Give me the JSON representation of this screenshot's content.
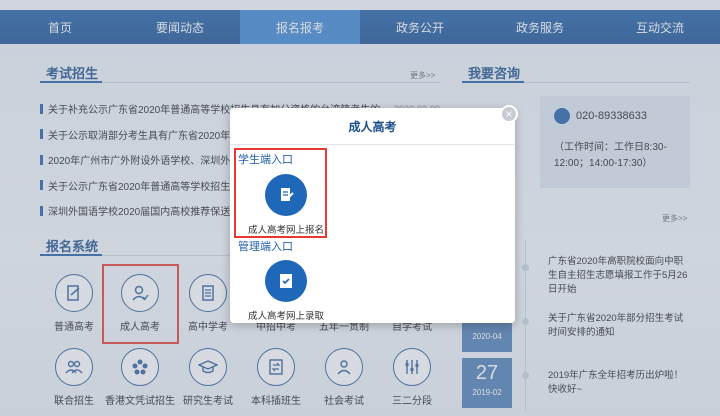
{
  "nav": {
    "items": [
      "首页",
      "要闻动态",
      "报名报考",
      "政务公开",
      "政务服务",
      "互动交流"
    ],
    "active_index": 2
  },
  "exam_section": {
    "title": "考试招生",
    "more": "更多>>",
    "news": [
      {
        "text": "关于补充公示广东省2020年普通高等学校招生具有加分资格的台湾籍考生的",
        "date": "2020-03-09"
      },
      {
        "text": "关于公示取消部分考生具有广东省2020年普通高",
        "date": ""
      },
      {
        "text": "2020年广州市广外附设外语学校、深圳外国语",
        "date": ""
      },
      {
        "text": "关于公示广东省2020年普通高等学校招生具有",
        "date": ""
      },
      {
        "text": "深圳外国语学校2020届国内高校推荐保送生工",
        "date": ""
      }
    ]
  },
  "reg_section": {
    "title": "报名系统",
    "icons": [
      {
        "label": "普通高考",
        "icon": "edit-doc-icon"
      },
      {
        "label": "成人高考",
        "icon": "user-check-icon"
      },
      {
        "label": "高中学考",
        "icon": "book-icon"
      },
      {
        "label": "中招中考",
        "icon": ""
      },
      {
        "label": "五年一贯制",
        "icon": ""
      },
      {
        "label": "自学考试",
        "icon": ""
      },
      {
        "label": "联合招生",
        "icon": "people-icon"
      },
      {
        "label": "香港文凭试招生",
        "icon": "flower-icon"
      },
      {
        "label": "研究生考试",
        "icon": "grad-cap-icon"
      },
      {
        "label": "本科插班生",
        "icon": "transfer-icon"
      },
      {
        "label": "社会考试",
        "icon": "person-icon"
      },
      {
        "label": "三二分段",
        "icon": "sliders-icon"
      }
    ]
  },
  "consult": {
    "title": "我要咨询",
    "phone": "020-89338633",
    "hours": "（工作时间：工作日8:30-12:00；14:00-17:30）"
  },
  "right_news": {
    "more": "更多>>",
    "items": [
      {
        "text": "广东省2020年高职院校面向中职生自主招生志愿填报工作于5月26日开始"
      },
      {
        "text": "关于广东省2020年部分招生考试时间安排的通知"
      },
      {
        "text": "2019年广东全年招考历出炉啦！快收好~"
      }
    ],
    "dates": [
      {
        "day": "30",
        "month": "2020-04"
      },
      {
        "day": "27",
        "month": "2019-02"
      }
    ]
  },
  "modal": {
    "title": "成人高考",
    "close": "×",
    "student_entry": "学生端入口",
    "student_btn": "成人高考网上报名",
    "admin_entry": "管理端入口",
    "admin_btn": "成人高考网上录取"
  },
  "colors": {
    "nav": "#1f5fa8",
    "accent": "#1f67b8",
    "highlight": "#e53935"
  }
}
